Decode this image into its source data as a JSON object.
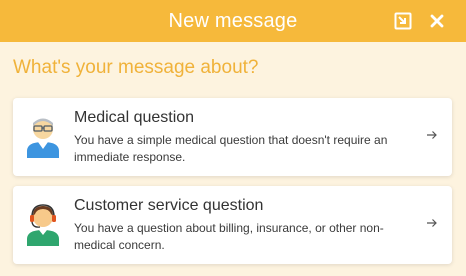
{
  "header": {
    "title": "New message",
    "popout_icon": "popout-icon",
    "close_icon": "close-icon"
  },
  "question": "What's your message about?",
  "options": [
    {
      "title": "Medical question",
      "description": "You have a simple medical question that doesn't require an immediate response.",
      "icon": "doctor-avatar-icon"
    },
    {
      "title": "Customer service question",
      "description": "You have a question about billing, insurance, or other non-medical concern.",
      "icon": "support-agent-avatar-icon"
    }
  ],
  "colors": {
    "header": "#f6b93b",
    "background": "#fdf3df",
    "accent_text": "#f0b23a"
  }
}
